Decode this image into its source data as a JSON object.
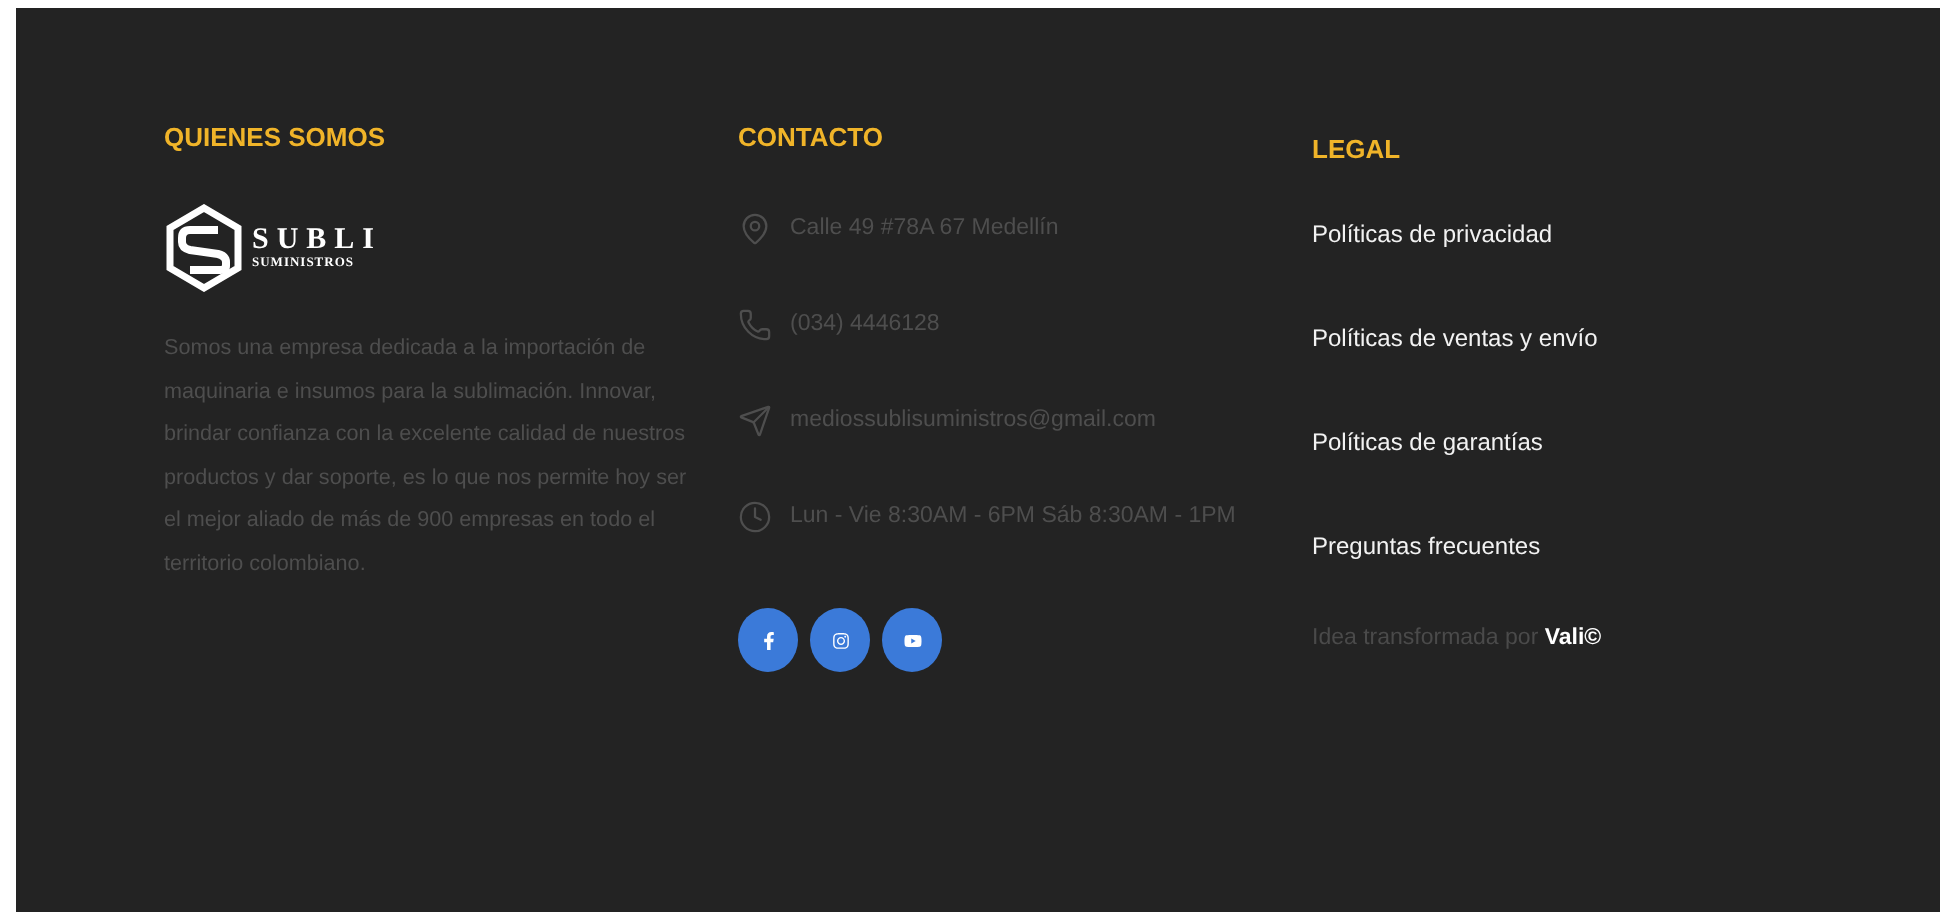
{
  "about": {
    "heading": "QUIENES SOMOS",
    "logo": {
      "name": "SUBLI",
      "tagline": "SUMINISTROS"
    },
    "text": "Somos una empresa dedicada a la importación de maquinaria e insumos para la sublimación. Innovar, brindar confianza con la excelente calidad de nuestros productos y dar soporte, es lo que nos permite hoy ser el mejor aliado de más de 900 empresas en todo el territorio colombiano."
  },
  "contact": {
    "heading": "CONTACTO",
    "items": [
      {
        "kind": "address",
        "text": "Calle 49 #78A 67 Medellín"
      },
      {
        "kind": "phone",
        "text": "(034) 4446128"
      },
      {
        "kind": "email",
        "text": "mediossublisuministros@gmail.com"
      },
      {
        "kind": "hours",
        "text": "Lun - Vie 8:30AM - 6PM Sáb 8:30AM - 1PM"
      }
    ],
    "social": [
      {
        "kind": "facebook"
      },
      {
        "kind": "instagram"
      },
      {
        "kind": "youtube"
      }
    ]
  },
  "legal": {
    "heading": "LEGAL",
    "links": [
      "Políticas de privacidad",
      "Políticas de ventas y envío",
      "Políticas de garantías",
      "Preguntas frecuentes"
    ],
    "credit": "Idea transformada por **Vali©**"
  }
}
